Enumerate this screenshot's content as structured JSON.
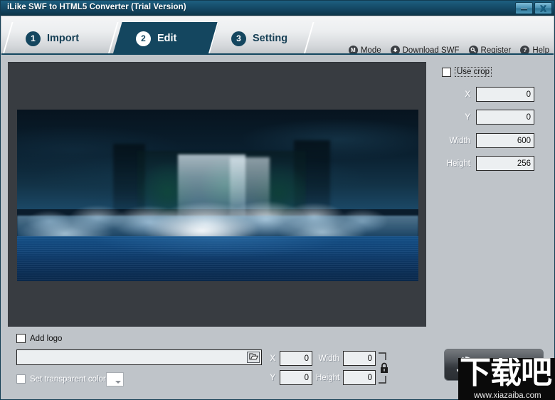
{
  "window": {
    "title": "iLike SWF to HTML5 Converter (Trial Version)",
    "minimize_icon": "minimize-icon",
    "close_icon": "close-icon",
    "border_color": "#123c52",
    "titlebar_color": "#14506e"
  },
  "tabs": [
    {
      "number": "1",
      "label": "Import",
      "active": false
    },
    {
      "number": "2",
      "label": "Edit",
      "active": true
    },
    {
      "number": "3",
      "label": "Setting",
      "active": false
    }
  ],
  "toolbar": [
    {
      "icon": "mode-icon",
      "glyph": "M",
      "label": "Mode"
    },
    {
      "icon": "download-icon",
      "glyph": "↓",
      "label": "Download SWF"
    },
    {
      "icon": "register-key-icon",
      "glyph": "⚿",
      "label": "Register"
    },
    {
      "icon": "help-icon",
      "glyph": "?",
      "label": "Help"
    }
  ],
  "preview": {
    "canvas_background": "#383c41",
    "image_description": "waterfall over icy cliffs into deep blue water",
    "image_width": "600",
    "image_height": "256"
  },
  "crop_panel": {
    "use_crop_label": "Use crop",
    "use_crop_checked": false,
    "use_crop_focused": true,
    "fields": [
      {
        "label": "X",
        "value": "0",
        "disabled": true
      },
      {
        "label": "Y",
        "value": "0",
        "disabled": true
      },
      {
        "label": "Width",
        "value": "600",
        "disabled": true
      },
      {
        "label": "Height",
        "value": "256",
        "disabled": true
      }
    ]
  },
  "logo_panel": {
    "add_logo_label": "Add logo",
    "add_logo_checked": false,
    "path_value": "",
    "path_placeholder": "",
    "browse_icon": "folder-open-icon",
    "transparent_label": "Set transparent color",
    "transparent_checked": false,
    "transparent_disabled": true,
    "color_swatch": "#ffffff",
    "fields": [
      {
        "label": "X",
        "value": "0",
        "disabled": true
      },
      {
        "label": "Y",
        "value": "0",
        "disabled": true
      },
      {
        "label": "Width",
        "value": "0",
        "disabled": true
      },
      {
        "label": "Height",
        "value": "0",
        "disabled": true
      }
    ],
    "lock_icon": "aspect-ratio-lock-icon"
  },
  "action_button": {
    "icon": "refresh-rotate-icon",
    "label": ""
  },
  "watermark": {
    "text": "下载吧",
    "url": "www.xiazaiba.com"
  }
}
